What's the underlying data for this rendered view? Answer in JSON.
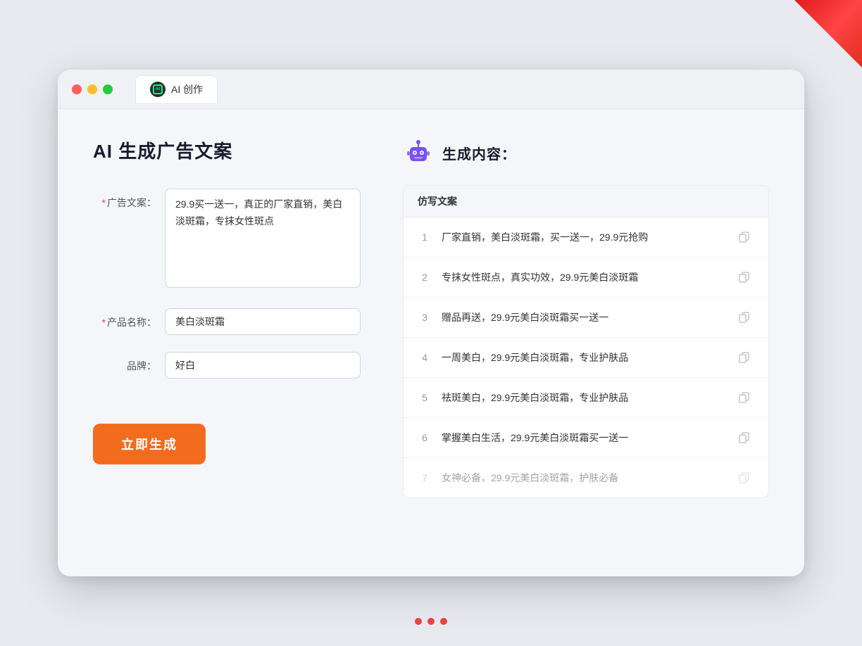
{
  "window": {
    "traffic_lights": [
      "red",
      "yellow",
      "green"
    ],
    "tab": {
      "icon_label": "AI",
      "label": "AI 创作"
    }
  },
  "left_panel": {
    "title": "AI 生成广告文案",
    "form": {
      "ad_copy_label": "广告文案：",
      "ad_copy_required": "*",
      "ad_copy_value": "29.9买一送一，真正的厂家直销，美白淡斑霜，专抹女性斑点",
      "product_name_label": "产品名称：",
      "product_name_required": "*",
      "product_name_value": "美白淡斑霜",
      "brand_label": "品牌：",
      "brand_value": "好白"
    },
    "generate_button": "立即生成"
  },
  "right_panel": {
    "title": "生成内容：",
    "table_header": "仿写文案",
    "results": [
      {
        "num": "1",
        "text": "厂家直销，美白淡斑霜，买一送一，29.9元抢购",
        "faded": false
      },
      {
        "num": "2",
        "text": "专抹女性斑点，真实功效，29.9元美白淡斑霜",
        "faded": false
      },
      {
        "num": "3",
        "text": "赠品再送，29.9元美白淡斑霜买一送一",
        "faded": false
      },
      {
        "num": "4",
        "text": "一周美白，29.9元美白淡斑霜，专业护肤品",
        "faded": false
      },
      {
        "num": "5",
        "text": "祛斑美白，29.9元美白淡斑霜，专业护肤品",
        "faded": false
      },
      {
        "num": "6",
        "text": "掌握美白生活，29.9元美白淡斑霜买一送一",
        "faded": false
      },
      {
        "num": "7",
        "text": "女神必备，29.9元美白淡斑霜，护肤必备",
        "faded": true
      }
    ]
  },
  "colors": {
    "accent_orange": "#f26c1e",
    "accent_red": "#e84545",
    "robot_purple": "#7c4dff",
    "robot_blue": "#42a5f5"
  }
}
